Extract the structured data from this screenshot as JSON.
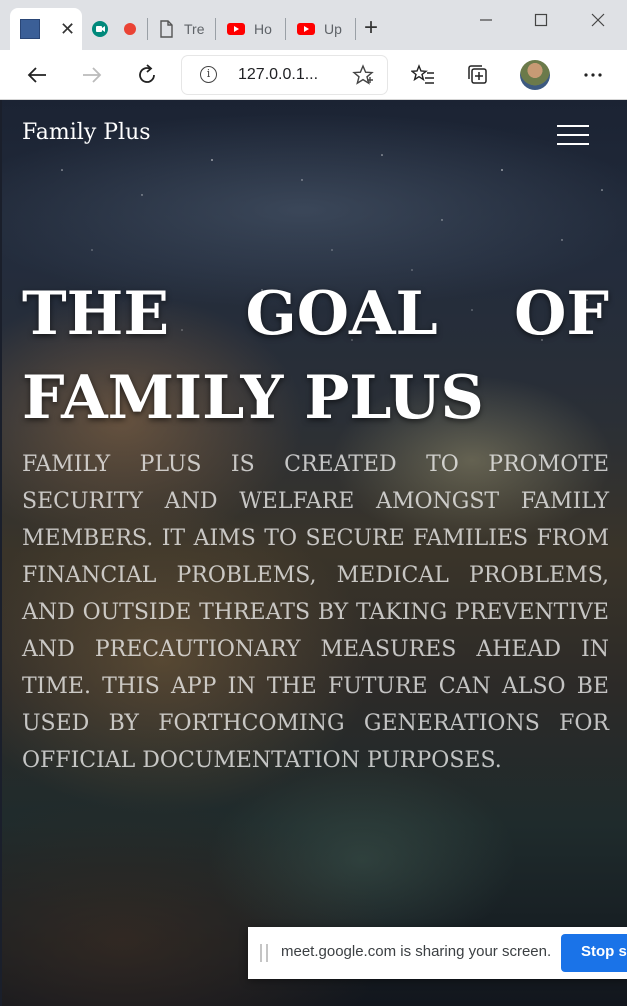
{
  "browser": {
    "tabs": [
      {
        "title": "",
        "favicon": "blue-square-icon",
        "active": true
      },
      {
        "title": "",
        "favicon": "google-meet-icon"
      },
      {
        "title": "",
        "favicon": "recording-dot-icon"
      },
      {
        "title": "Tre",
        "favicon": "document-icon"
      },
      {
        "title": "Ho",
        "favicon": "youtube-icon"
      },
      {
        "title": "Up",
        "favicon": "youtube-icon"
      }
    ],
    "address": "127.0.0.1...",
    "colors": {
      "tabbar": "#dfe1e5",
      "youtube": "#ff0000",
      "recording": "#ea4335",
      "meet": "#00897b"
    }
  },
  "nav": {
    "brand": "Family Plus"
  },
  "hero": {
    "title_line1_words": [
      "THE",
      "GOAL",
      "OF"
    ],
    "title_line2": "FAMILY PLUS",
    "body": "Family Plus is created to promote security and welfare amongst family members. It aims to secure families from financial problems, medical problems, and outside threats by taking preventive and precautionary measures ahead in time. This app in the future can also be used by forthcoming generations for official documentation purposes."
  },
  "share_bar": {
    "message": "meet.google.com is sharing your screen.",
    "stop_label": "Stop sh",
    "button_color": "#1a73e8"
  }
}
